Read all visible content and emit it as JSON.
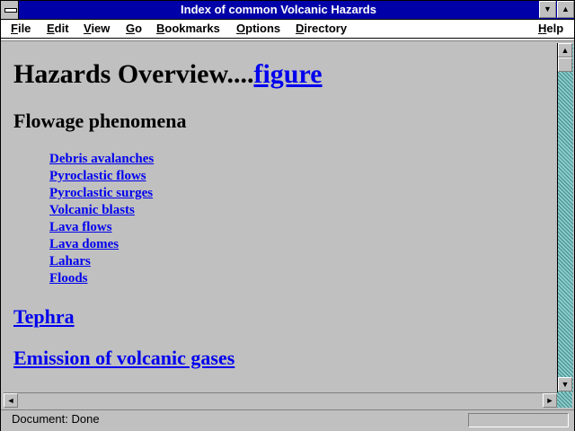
{
  "window": {
    "title": "Index of common Volcanic Hazards"
  },
  "menu": [
    {
      "key": "F",
      "rest": "ile"
    },
    {
      "key": "E",
      "rest": "dit"
    },
    {
      "key": "V",
      "rest": "iew"
    },
    {
      "key": "G",
      "rest": "o"
    },
    {
      "key": "B",
      "rest": "ookmarks"
    },
    {
      "key": "O",
      "rest": "ptions"
    },
    {
      "key": "D",
      "rest": "irectory"
    },
    {
      "key": "H",
      "rest": "elp"
    }
  ],
  "page": {
    "heading_text": "Hazards Overview....",
    "heading_link": "figure",
    "subheading": "Flowage phenomena",
    "flowage_links": [
      "Debris avalanches",
      "Pyroclastic flows",
      "Pyroclastic surges",
      "Volcanic blasts",
      "Lava flows",
      "Lava domes",
      "Lahars",
      "Floods"
    ],
    "tephra_link": "Tephra",
    "gases_link": "Emission of volcanic gases"
  },
  "status": {
    "text": "Document: Done"
  }
}
